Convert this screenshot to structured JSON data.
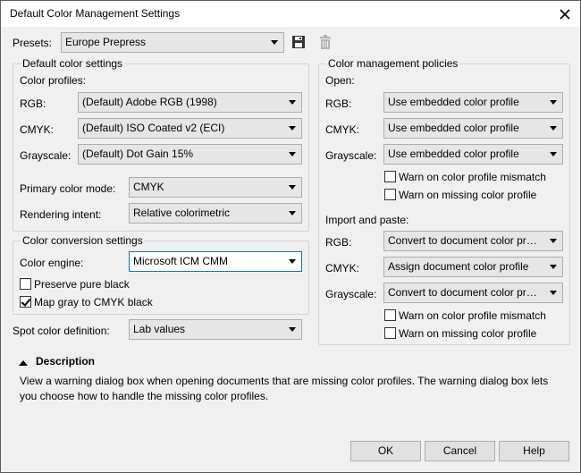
{
  "window": {
    "title": "Default Color Management Settings"
  },
  "presets": {
    "label": "Presets:",
    "value": "Europe Prepress",
    "save_icon": "save-icon",
    "delete_icon": "trash-icon"
  },
  "default_color": {
    "group_title": "Default color settings",
    "profiles_label": "Color profiles:",
    "rgb_label": "RGB:",
    "rgb_value": "(Default) Adobe RGB (1998)",
    "cmyk_label": "CMYK:",
    "cmyk_value": "(Default) ISO Coated v2 (ECI)",
    "gray_label": "Grayscale:",
    "gray_value": "(Default) Dot Gain 15%",
    "primary_label": "Primary color mode:",
    "primary_value": "CMYK",
    "intent_label": "Rendering intent:",
    "intent_value": "Relative colorimetric"
  },
  "conversion": {
    "group_title": "Color conversion settings",
    "engine_label": "Color engine:",
    "engine_value": "Microsoft ICM CMM",
    "preserve_label": "Preserve pure black",
    "preserve_checked": false,
    "mapgray_label": "Map gray to CMYK black",
    "mapgray_checked": true
  },
  "spot": {
    "label": "Spot color definition:",
    "value": "Lab values"
  },
  "policies": {
    "group_title": "Color management policies",
    "open_label": "Open:",
    "open_rgb_label": "RGB:",
    "open_rgb_value": "Use embedded color profile",
    "open_cmyk_label": "CMYK:",
    "open_cmyk_value": "Use embedded color profile",
    "open_gray_label": "Grayscale:",
    "open_gray_value": "Use embedded color profile",
    "open_warn_mismatch": "Warn on color profile mismatch",
    "open_warn_missing": "Warn on missing color profile",
    "import_label": "Import and paste:",
    "imp_rgb_label": "RGB:",
    "imp_rgb_value": "Convert to document color profile",
    "imp_cmyk_label": "CMYK:",
    "imp_cmyk_value": "Assign document color profile",
    "imp_gray_label": "Grayscale:",
    "imp_gray_value": "Convert to document color profile",
    "imp_warn_mismatch": "Warn on color profile mismatch",
    "imp_warn_missing": "Warn on missing color profile"
  },
  "description": {
    "title": "Description",
    "text": "View a warning dialog box when opening documents that are missing color profiles. The warning dialog box lets you choose how to handle the missing color profiles."
  },
  "buttons": {
    "ok": "OK",
    "cancel": "Cancel",
    "help": "Help"
  }
}
